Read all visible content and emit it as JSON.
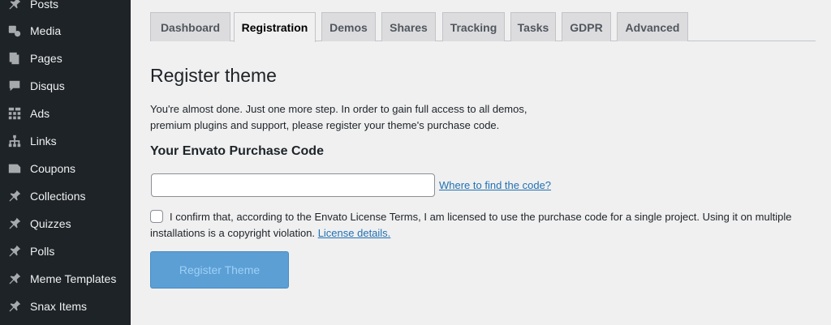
{
  "sidebar": {
    "items": [
      {
        "label": "Posts",
        "icon": "pin-icon"
      },
      {
        "label": "Media",
        "icon": "media-icon"
      },
      {
        "label": "Pages",
        "icon": "pages-icon"
      },
      {
        "label": "Disqus",
        "icon": "comment-icon"
      },
      {
        "label": "Ads",
        "icon": "ads-icon"
      },
      {
        "label": "Links",
        "icon": "links-icon"
      },
      {
        "label": "Coupons",
        "icon": "coupons-icon"
      },
      {
        "label": "Collections",
        "icon": "pin-icon"
      },
      {
        "label": "Quizzes",
        "icon": "pin-icon"
      },
      {
        "label": "Polls",
        "icon": "pin-icon"
      },
      {
        "label": "Meme Templates",
        "icon": "pin-icon"
      },
      {
        "label": "Snax Items",
        "icon": "pin-icon"
      }
    ]
  },
  "tabs": [
    {
      "label": "Dashboard"
    },
    {
      "label": "Registration",
      "active": true
    },
    {
      "label": "Demos"
    },
    {
      "label": "Shares"
    },
    {
      "label": "Tracking"
    },
    {
      "label": "Tasks"
    },
    {
      "label": "GDPR"
    },
    {
      "label": "Advanced"
    }
  ],
  "page": {
    "title": "Register theme",
    "intro": "You're almost done. Just one more step. In order to gain full access to all demos, premium plugins and support, please register your theme's purchase code.",
    "subheading": "Your Envato Purchase Code",
    "input_value": "",
    "find_link": "Where to find the code?",
    "confirm_text": "I confirm that, according to the Envato License Terms, I am licensed to use the purchase code for a single project. Using it on multiple installations is a copyright violation.",
    "license_link": "License details.",
    "register_button": "Register Theme"
  },
  "colors": {
    "sidebar_bg": "#1d2327",
    "accent": "#2271b1",
    "button_bg": "#5b9fd5"
  }
}
